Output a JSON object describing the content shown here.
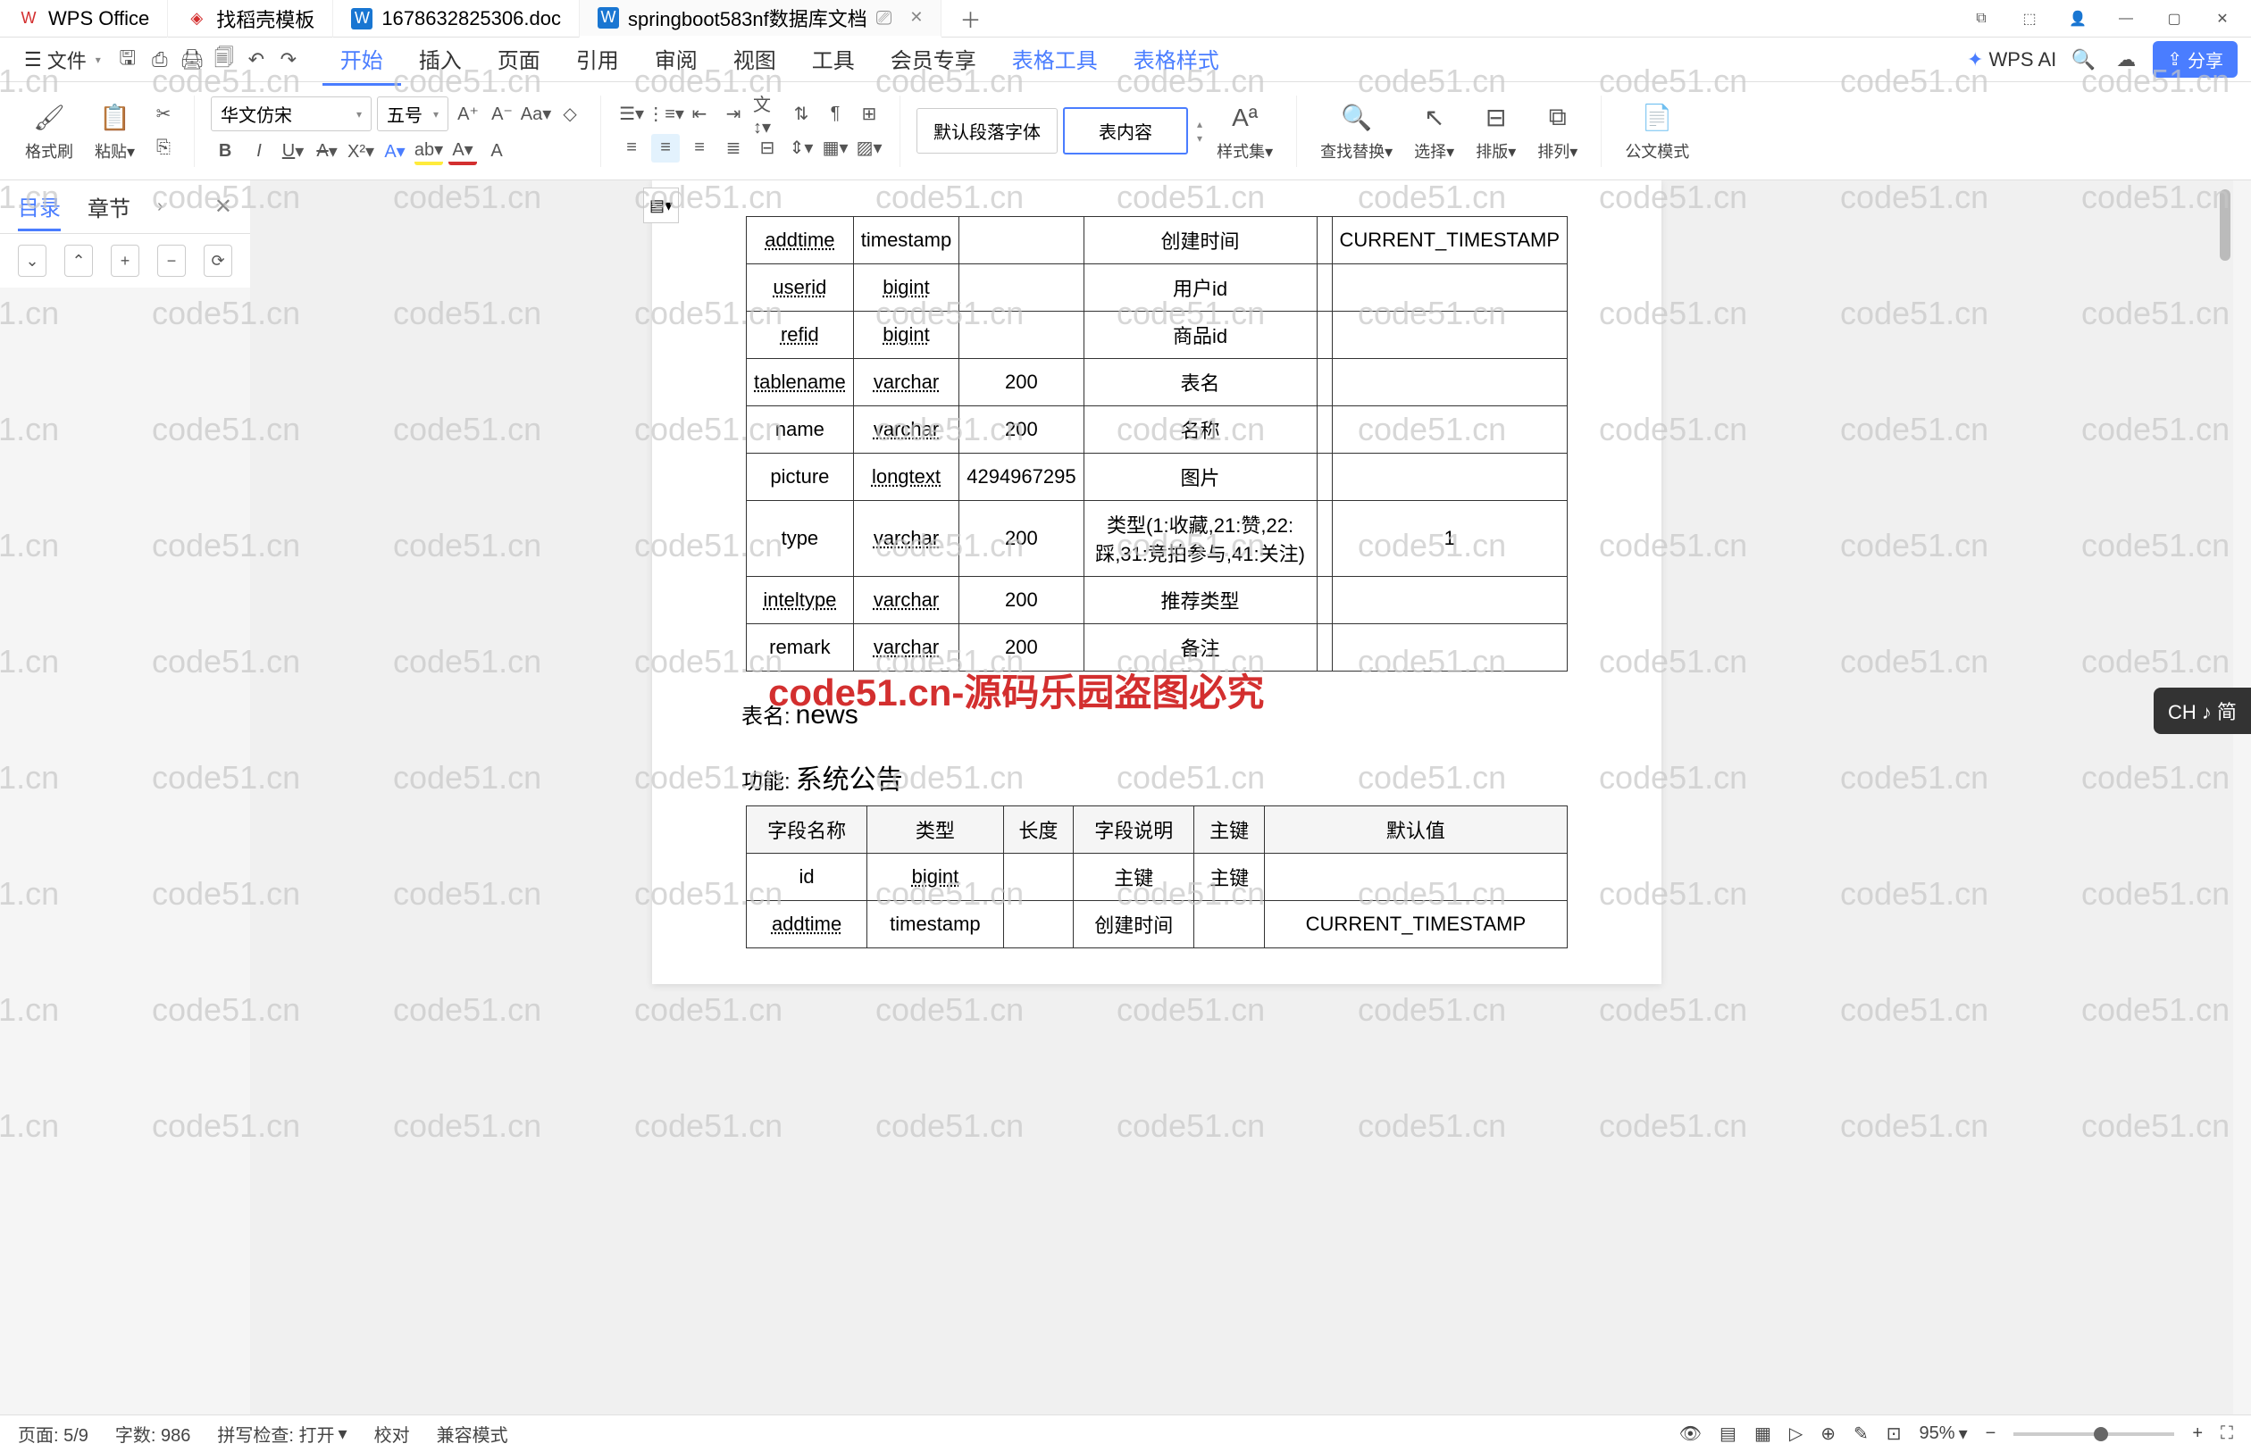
{
  "app_tabs": [
    {
      "icon": "W",
      "label": "WPS Office",
      "icon_color": "red"
    },
    {
      "icon": "D",
      "label": "找稻壳模板",
      "icon_color": "red"
    },
    {
      "icon": "W",
      "label": "1678632825306.doc",
      "icon_color": "blue"
    },
    {
      "icon": "W",
      "label": "springboot583nf数据库文档",
      "icon_color": "blue",
      "active": true,
      "has_monitor": true
    }
  ],
  "menu": {
    "file_label": "文件",
    "tabs": [
      "开始",
      "插入",
      "页面",
      "引用",
      "审阅",
      "视图",
      "工具",
      "会员专享",
      "表格工具",
      "表格样式"
    ],
    "active_tab": "开始",
    "wps_ai": "WPS AI",
    "share": "分享"
  },
  "toolbar": {
    "format_brush": "格式刷",
    "paste": "粘贴",
    "font_name": "华文仿宋",
    "font_size": "五号",
    "para_style1": "默认段落字体",
    "para_style2": "表内容",
    "style_set": "样式集",
    "find_replace": "查找替换",
    "select": "选择",
    "arrange": "排版",
    "arrange2": "排列",
    "doc_mode": "公文模式"
  },
  "sidebar": {
    "tab_toc": "目录",
    "tab_chapter": "章节"
  },
  "doc": {
    "table1": [
      {
        "field": "addtime",
        "type": "timestamp",
        "len": "",
        "desc": "创建时间",
        "pk": "",
        "def": "CURRENT_TIMESTAMP"
      },
      {
        "field": "userid",
        "type": "bigint",
        "len": "",
        "desc": "用户id",
        "pk": "",
        "def": ""
      },
      {
        "field": "refid",
        "type": "bigint",
        "len": "",
        "desc": "商品id",
        "pk": "",
        "def": ""
      },
      {
        "field": "tablename",
        "type": "varchar",
        "len": "200",
        "desc": "表名",
        "pk": "",
        "def": ""
      },
      {
        "field": "name",
        "type": "varchar",
        "len": "200",
        "desc": "名称",
        "pk": "",
        "def": ""
      },
      {
        "field": "picture",
        "type": "longtext",
        "len": "4294967295",
        "desc": "图片",
        "pk": "",
        "def": ""
      },
      {
        "field": "type",
        "type": "varchar",
        "len": "200",
        "desc": "类型(1:收藏,21:赞,22:踩,31:竞拍参与,41:关注)",
        "pk": "",
        "def": "1"
      },
      {
        "field": "inteltype",
        "type": "varchar",
        "len": "200",
        "desc": "推荐类型",
        "pk": "",
        "def": ""
      },
      {
        "field": "remark",
        "type": "varchar",
        "len": "200",
        "desc": "备注",
        "pk": "",
        "def": ""
      }
    ],
    "table2_name_label": "表名:",
    "table2_name": "news",
    "table2_func_label": "功能:",
    "table2_func": "系统公告",
    "table2_headers": [
      "字段名称",
      "类型",
      "长度",
      "字段说明",
      "主键",
      "默认值"
    ],
    "table2": [
      {
        "field": "id",
        "type": "bigint",
        "len": "",
        "desc": "主键",
        "pk": "主键",
        "def": ""
      },
      {
        "field": "addtime",
        "type": "timestamp",
        "len": "",
        "desc": "创建时间",
        "pk": "",
        "def": "CURRENT_TIMESTAMP"
      }
    ]
  },
  "watermark_text": "code51.cn",
  "watermark_red": "code51.cn-源码乐园盗图必究",
  "statusbar": {
    "page": "页面: 5/9",
    "words": "字数: 986",
    "spell": "拼写检查: 打开",
    "proof": "校对",
    "compat": "兼容模式",
    "zoom": "95%"
  },
  "ch_indicator": "CH ♪ 简"
}
